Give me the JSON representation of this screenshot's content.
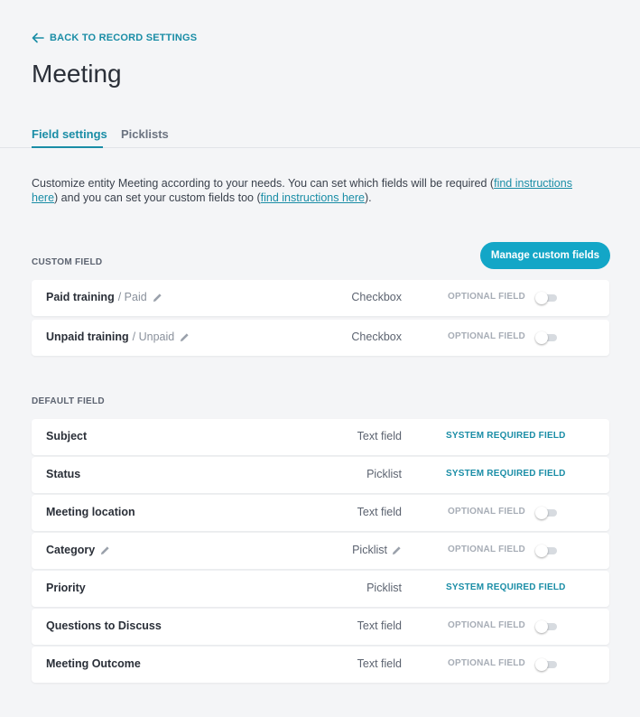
{
  "back_label": "BACK TO RECORD SETTINGS",
  "page_title": "Meeting",
  "tabs": [
    {
      "label": "Field settings",
      "active": true
    },
    {
      "label": "Picklists",
      "active": false
    }
  ],
  "description": {
    "part1": "Customize entity Meeting according to your needs. You can set which fields will be required (",
    "link1": "find instructions here",
    "part2": ") and you can set your custom fields too (",
    "link2": "find instructions here",
    "part3": ")."
  },
  "custom_section": {
    "label": "CUSTOM FIELD",
    "manage_button": "Manage custom fields",
    "rows": [
      {
        "name": "Paid training",
        "sub": "/ Paid",
        "type": "Checkbox",
        "status": "OPTIONAL FIELD"
      },
      {
        "name": "Unpaid training",
        "sub": "/ Unpaid",
        "type": "Checkbox",
        "status": "OPTIONAL FIELD"
      }
    ]
  },
  "default_section": {
    "label": "DEFAULT FIELD",
    "rows": [
      {
        "name": "Subject",
        "type": "Text field",
        "status": "SYSTEM REQUIRED FIELD"
      },
      {
        "name": "Status",
        "type": "Picklist",
        "status": "SYSTEM REQUIRED FIELD"
      },
      {
        "name": "Meeting location",
        "type": "Text field",
        "status": "OPTIONAL FIELD"
      },
      {
        "name": "Category",
        "type": "Picklist",
        "status": "OPTIONAL FIELD"
      },
      {
        "name": "Priority",
        "type": "Picklist",
        "status": "SYSTEM REQUIRED FIELD"
      },
      {
        "name": "Questions to Discuss",
        "type": "Text field",
        "status": "OPTIONAL FIELD"
      },
      {
        "name": "Meeting Outcome",
        "type": "Text field",
        "status": "OPTIONAL FIELD"
      }
    ]
  },
  "colors": {
    "accent": "#1a8da6",
    "button": "#13a6c7",
    "background": "#f4f5f7"
  }
}
